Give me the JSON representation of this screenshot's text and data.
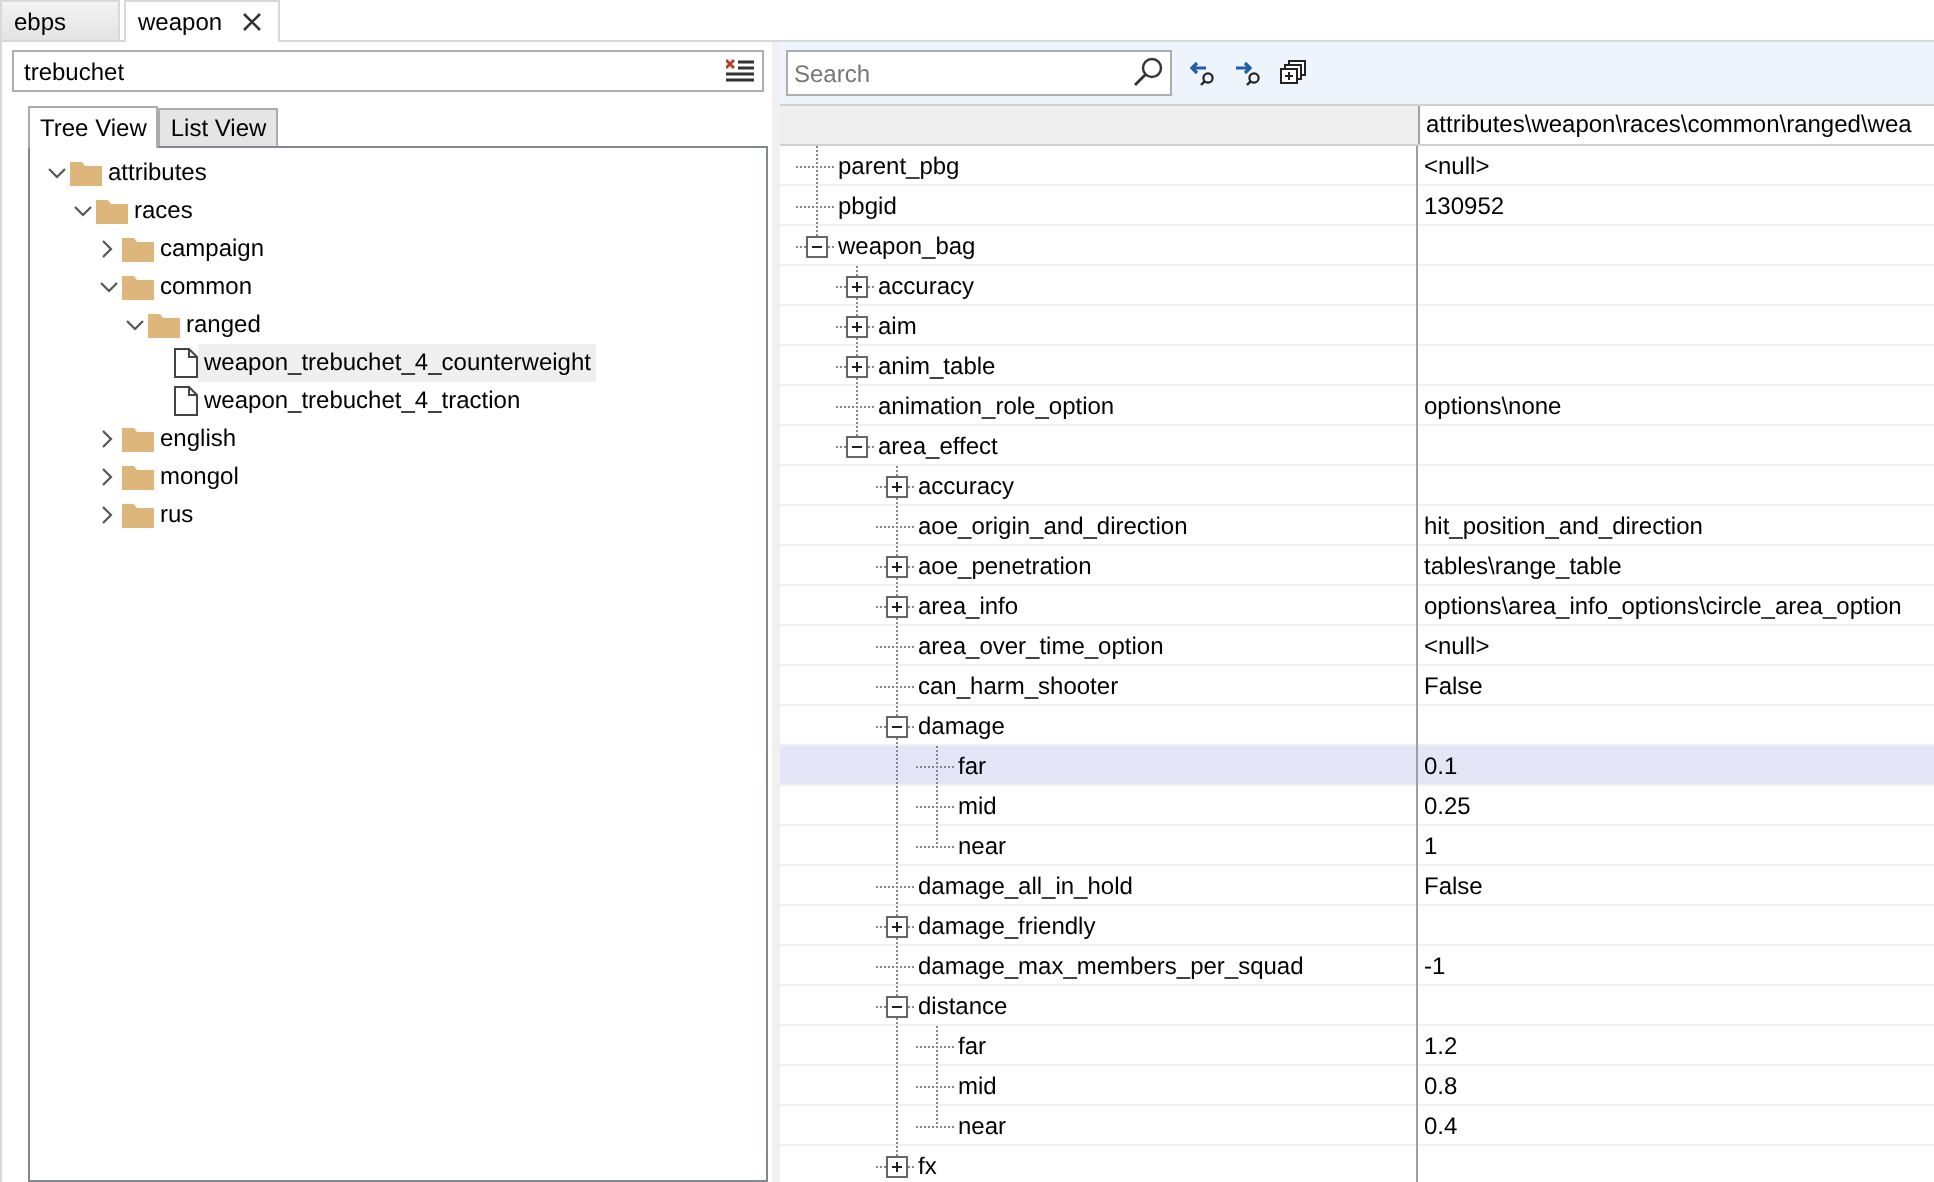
{
  "tabs": [
    {
      "label": "ebps",
      "selected": false,
      "closable": false
    },
    {
      "label": "weapon",
      "selected": true,
      "closable": true
    }
  ],
  "filter": {
    "value": "trebuchet"
  },
  "view_tabs": [
    {
      "label": "Tree View",
      "selected": true
    },
    {
      "label": "List View",
      "selected": false
    }
  ],
  "file_tree": [
    {
      "label": "attributes",
      "kind": "folder",
      "expanded": true,
      "selected": false,
      "children": [
        {
          "label": "races",
          "kind": "folder",
          "expanded": true,
          "selected": false,
          "children": [
            {
              "label": "campaign",
              "kind": "folder",
              "expanded": false,
              "selected": false
            },
            {
              "label": "common",
              "kind": "folder",
              "expanded": true,
              "selected": false,
              "children": [
                {
                  "label": "ranged",
                  "kind": "folder",
                  "expanded": true,
                  "selected": false,
                  "children": [
                    {
                      "label": "weapon_trebuchet_4_counterweight",
                      "kind": "file",
                      "selected": true
                    },
                    {
                      "label": "weapon_trebuchet_4_traction",
                      "kind": "file",
                      "selected": false
                    }
                  ]
                }
              ]
            },
            {
              "label": "english",
              "kind": "folder",
              "expanded": false,
              "selected": false
            },
            {
              "label": "mongol",
              "kind": "folder",
              "expanded": false,
              "selected": false
            },
            {
              "label": "rus",
              "kind": "folder",
              "expanded": false,
              "selected": false
            }
          ]
        }
      ]
    }
  ],
  "toolbar": {
    "search": {
      "placeholder": "Search"
    }
  },
  "grid": {
    "column_header": "attributes\\weapon\\races\\common\\ranged\\wea",
    "rows": [
      {
        "name": "parent_pbg",
        "value": "<null>",
        "selected": false
      },
      {
        "name": "pbgid",
        "value": "130952",
        "selected": false
      },
      {
        "name": "weapon_bag",
        "expanded": true,
        "selected": false,
        "children": [
          {
            "name": "accuracy",
            "expanded": false,
            "selected": false
          },
          {
            "name": "aim",
            "expanded": false,
            "selected": false
          },
          {
            "name": "anim_table",
            "expanded": false,
            "selected": false
          },
          {
            "name": "animation_role_option",
            "value": "options\\none",
            "selected": false
          },
          {
            "name": "area_effect",
            "expanded": true,
            "selected": false,
            "children": [
              {
                "name": "accuracy",
                "expanded": false,
                "selected": false
              },
              {
                "name": "aoe_origin_and_direction",
                "value": "hit_position_and_direction",
                "selected": false
              },
              {
                "name": "aoe_penetration",
                "expanded": false,
                "value": "tables\\range_table",
                "selected": false
              },
              {
                "name": "area_info",
                "expanded": false,
                "value": "options\\area_info_options\\circle_area_option",
                "selected": false
              },
              {
                "name": "area_over_time_option",
                "value": "<null>",
                "selected": false
              },
              {
                "name": "can_harm_shooter",
                "value": "False",
                "selected": false
              },
              {
                "name": "damage",
                "expanded": true,
                "selected": false,
                "children": [
                  {
                    "name": "far",
                    "value": "0.1",
                    "selected": true
                  },
                  {
                    "name": "mid",
                    "value": "0.25",
                    "selected": false
                  },
                  {
                    "name": "near",
                    "value": "1",
                    "selected": false
                  }
                ]
              },
              {
                "name": "damage_all_in_hold",
                "value": "False",
                "selected": false
              },
              {
                "name": "damage_friendly",
                "expanded": false,
                "selected": false
              },
              {
                "name": "damage_max_members_per_squad",
                "value": "-1",
                "selected": false
              },
              {
                "name": "distance",
                "expanded": true,
                "selected": false,
                "children": [
                  {
                    "name": "far",
                    "value": "1.2",
                    "selected": false
                  },
                  {
                    "name": "mid",
                    "value": "0.8",
                    "selected": false
                  },
                  {
                    "name": "near",
                    "value": "0.4",
                    "selected": false
                  }
                ]
              },
              {
                "name": "fx",
                "expanded": false,
                "selected": false
              }
            ]
          }
        ]
      }
    ]
  }
}
